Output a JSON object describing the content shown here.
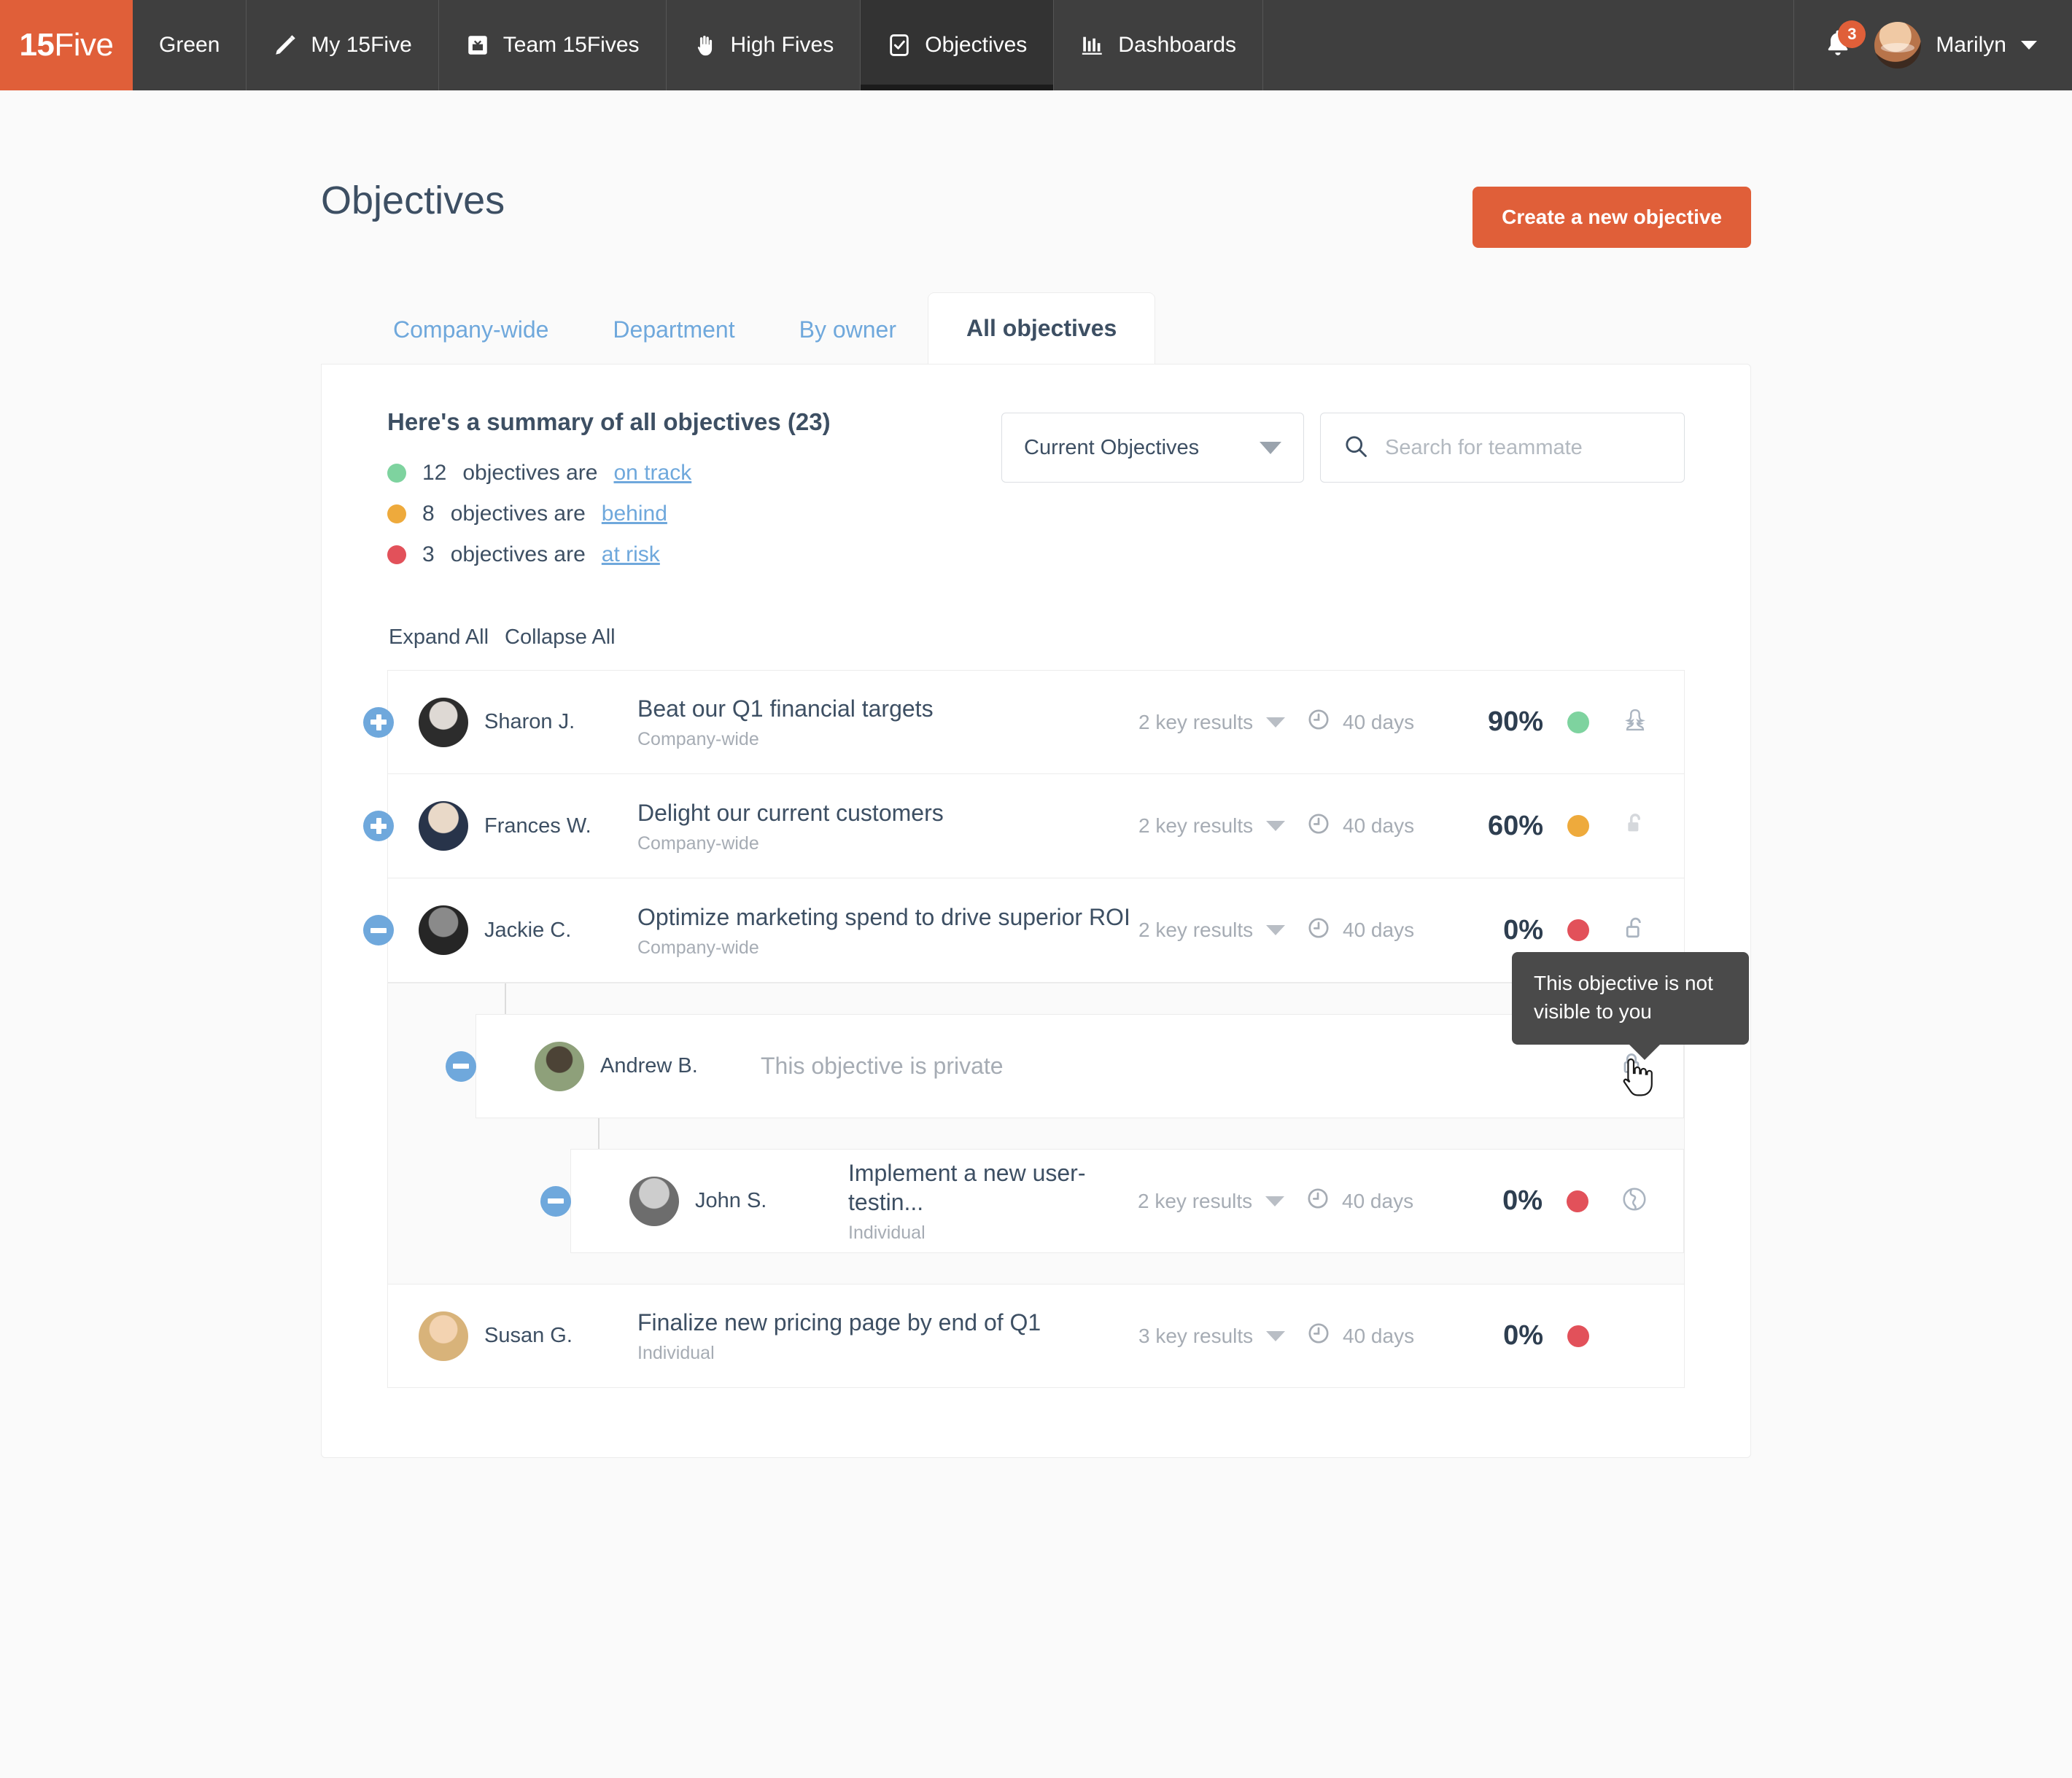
{
  "navbar": {
    "brand_prefix": "15",
    "brand_suffix": "Five",
    "workspace": "Green",
    "items": [
      {
        "label": "My 15Five",
        "icon": "pencil-icon",
        "active": false
      },
      {
        "label": "Team 15Fives",
        "icon": "inbox-icon",
        "active": false
      },
      {
        "label": "High Fives",
        "icon": "hand-icon",
        "active": false
      },
      {
        "label": "Objectives",
        "icon": "checkbox-icon",
        "active": true
      },
      {
        "label": "Dashboards",
        "icon": "bar-chart-icon",
        "active": false
      }
    ],
    "notification_count": "3",
    "user_name": "Marilyn"
  },
  "header": {
    "title": "Objectives",
    "create_button": "Create a new objective"
  },
  "tabs": [
    {
      "label": "Company-wide",
      "active": false
    },
    {
      "label": "Department",
      "active": false
    },
    {
      "label": "By owner",
      "active": false
    },
    {
      "label": "All objectives",
      "active": true
    }
  ],
  "summary": {
    "title": "Here's a summary of all objectives (23)",
    "lines": [
      {
        "count": "12",
        "text": "objectives are",
        "link": "on track",
        "color": "#7ed39f"
      },
      {
        "count": "8",
        "text": "objectives are",
        "link": "behind",
        "color": "#eeaa3c"
      },
      {
        "count": "3",
        "text": "objectives are",
        "link": "at risk",
        "color": "#e2515a"
      }
    ]
  },
  "controls": {
    "filter_value": "Current Objectives",
    "search_placeholder": "Search for teammate",
    "search_value": ""
  },
  "tree_controls": {
    "expand_all": "Expand All",
    "collapse_all": "Collapse All"
  },
  "tooltip": {
    "text": "This objective is not visible to you"
  },
  "objectives": [
    {
      "owner": "Sharon J.",
      "title": "Beat our Q1 financial targets",
      "type": "Company-wide",
      "key_results": "2 key results",
      "days": "40 days",
      "percent": "90%",
      "status_color": "#7ed39f",
      "visibility_icon": "person-icon",
      "expander": "plus"
    },
    {
      "owner": "Frances W.",
      "title": "Delight our current customers",
      "type": "Company-wide",
      "key_results": "2 key results",
      "days": "40 days",
      "percent": "60%",
      "status_color": "#eeaa3c",
      "visibility_icon": "unlock-filled-icon",
      "expander": "plus"
    },
    {
      "owner": "Jackie C.",
      "title": "Optimize marketing spend to drive superior ROI",
      "type": "Company-wide",
      "key_results": "2 key results",
      "days": "40 days",
      "percent": "0%",
      "status_color": "#e2515a",
      "visibility_icon": "unlock-outline-icon",
      "expander": "minus"
    },
    {
      "owner": "Andrew B.",
      "title": "This objective is private",
      "type": "",
      "key_results": "",
      "days": "",
      "percent": "",
      "status_color": "",
      "visibility_icon": "lock-closed-icon",
      "expander": "minus"
    },
    {
      "owner": "John S.",
      "title": "Implement a new user-testin...",
      "type": "Individual",
      "key_results": "2 key results",
      "days": "40 days",
      "percent": "0%",
      "status_color": "#e2515a",
      "visibility_icon": "globe-icon",
      "expander": "minus"
    },
    {
      "owner": "Susan G.",
      "title": "Finalize new pricing page by end of Q1",
      "type": "Individual",
      "key_results": "3 key results",
      "days": "40 days",
      "percent": "0%",
      "status_color": "#e2515a",
      "visibility_icon": "",
      "expander": ""
    }
  ]
}
